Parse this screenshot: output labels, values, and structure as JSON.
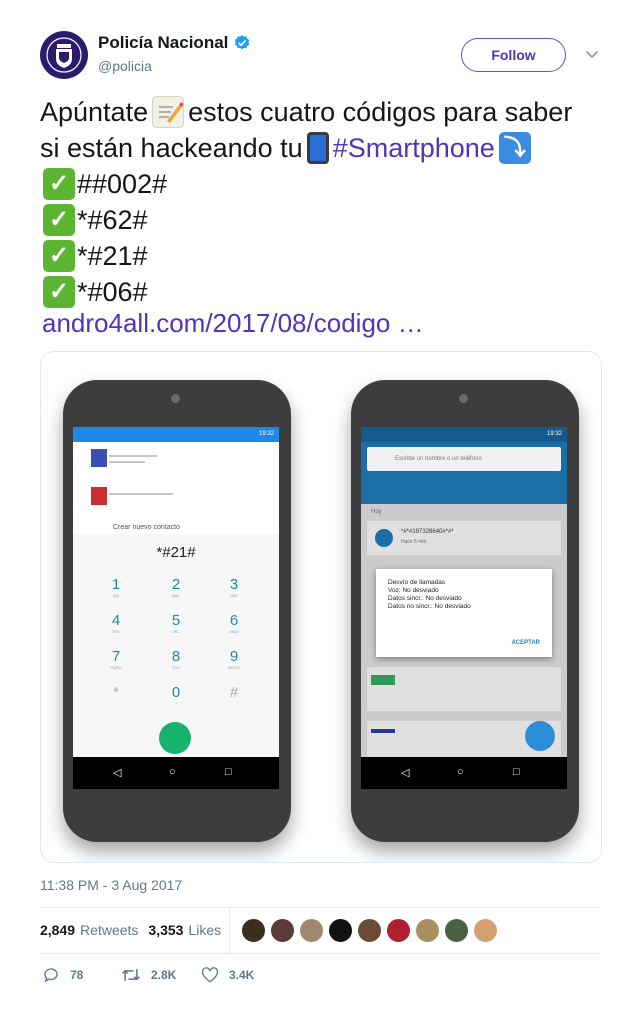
{
  "author": {
    "name": "Policía Nacional",
    "handle": "@policia",
    "verified": true
  },
  "follow_label": "Follow",
  "tweet": {
    "line1_before": "Apúntate",
    "line1_after": "estos cuatro códigos para saber",
    "line2_before": "si están hackeando tu",
    "hashtag": "#Smartphone",
    "codes": [
      "##002#",
      "*#62#",
      "*#21#",
      "*#06#"
    ],
    "link": "andro4all.com/2017/08/codigo …"
  },
  "media": {
    "phone1": {
      "status_time": "19:32",
      "new_contact": "Crear nuevo contacto",
      "dialed": "*#21#",
      "keys": [
        {
          "digit": "1",
          "letters": "QO"
        },
        {
          "digit": "2",
          "letters": "ABC"
        },
        {
          "digit": "3",
          "letters": "DEF"
        },
        {
          "digit": "4",
          "letters": "GHI"
        },
        {
          "digit": "5",
          "letters": "JKL"
        },
        {
          "digit": "6",
          "letters": "MNO"
        },
        {
          "digit": "7",
          "letters": "PQRS"
        },
        {
          "digit": "8",
          "letters": "TUV"
        },
        {
          "digit": "9",
          "letters": "WXYZ"
        },
        {
          "digit": "*",
          "letters": ""
        },
        {
          "digit": "0",
          "letters": "+"
        },
        {
          "digit": "#",
          "letters": ""
        }
      ]
    },
    "phone2": {
      "status_time": "19:32",
      "search_placeholder": "Escribe un nombre o un teléfono",
      "section": "Hoy",
      "recent_number": "*#*#197328640#*#*",
      "recent_time": "Hace 5 min",
      "dialog_title": "Desvío de llamadas",
      "dialog_lines": [
        "Voz: No desviado",
        "Datos sincr.: No desviado",
        "Datos no sincr.: No desviado"
      ],
      "dialog_ok": "ACEPTAR"
    }
  },
  "timestamp": "11:38 PM - 3 Aug 2017",
  "stats": {
    "retweets_count": "2,849",
    "retweets_label": "Retweets",
    "likes_count": "3,353",
    "likes_label": "Likes"
  },
  "liker_avatar_colors": [
    "#3b3020",
    "#5a3a3a",
    "#a08870",
    "#111111",
    "#6d4a32",
    "#b02030",
    "#a89060",
    "#4a6040",
    "#d4a070"
  ],
  "actions": {
    "replies": "78",
    "retweets": "2.8K",
    "likes": "3.4K"
  },
  "colors": {
    "accent": "#4f35b8",
    "verified": "#1da1f2",
    "muted": "#657786"
  }
}
